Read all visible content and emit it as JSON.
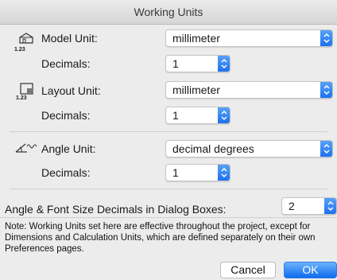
{
  "window": {
    "title": "Working Units"
  },
  "model": {
    "label": "Model Unit:",
    "value": "millimeter",
    "decimals_label": "Decimals:",
    "decimals_value": "1",
    "icon": "model-unit-icon",
    "icon_caption": "1.23"
  },
  "layout": {
    "label": "Layout Unit:",
    "value": "millimeter",
    "decimals_label": "Decimals:",
    "decimals_value": "1",
    "icon": "layout-unit-icon",
    "icon_caption": "1.23"
  },
  "angle": {
    "label": "Angle Unit:",
    "value": "decimal degrees",
    "decimals_label": "Decimals:",
    "decimals_value": "1",
    "icon": "angle-unit-icon"
  },
  "dialog_decimals": {
    "label": "Angle & Font Size Decimals in Dialog Boxes:",
    "value": "2"
  },
  "note": "Note: Working Units set here are effective throughout the project, except for Dimensions and Calculation Units, which are defined separately on their own Preferences pages.",
  "buttons": {
    "cancel": "Cancel",
    "ok": "OK"
  },
  "colors": {
    "accent": "#1b6ff0",
    "background": "#ececec"
  }
}
